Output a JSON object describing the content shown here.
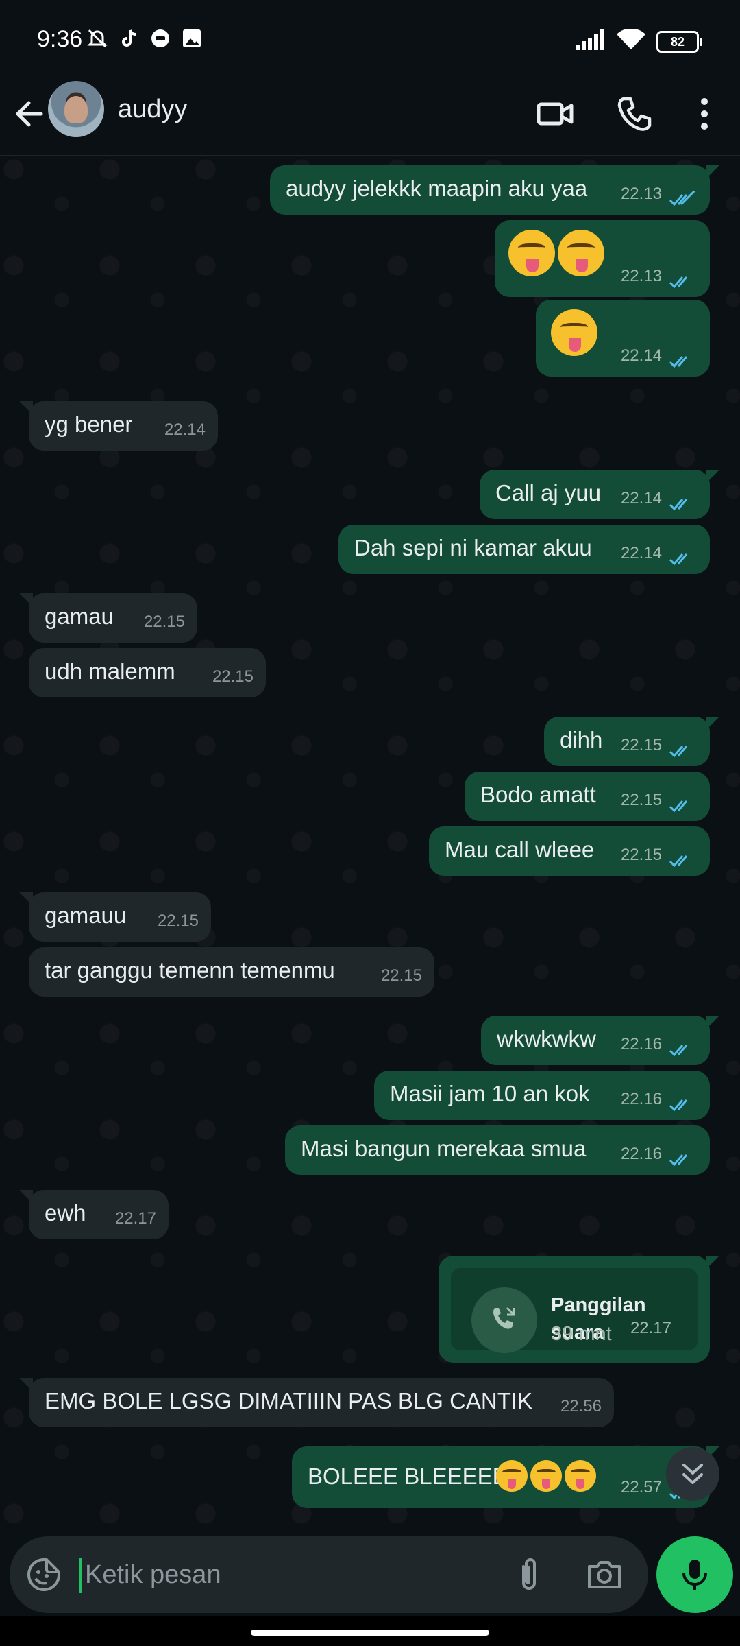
{
  "status_bar": {
    "time": "9:36",
    "battery": "82"
  },
  "header": {
    "contact_name": "audyy"
  },
  "messages": [
    {
      "dir": "out",
      "text": "audyy jelekkk maapin aku yaa",
      "time": "22.13"
    },
    {
      "dir": "out",
      "emoji": [
        "squinting-face-with-tongue",
        "squinting-face-with-tongue"
      ],
      "time": "22.13"
    },
    {
      "dir": "out",
      "emoji": [
        "face-savoring-food"
      ],
      "time": "22.14"
    },
    {
      "dir": "in",
      "text": "yg bener",
      "time": "22.14"
    },
    {
      "dir": "out",
      "text": "Call aj yuu",
      "time": "22.14"
    },
    {
      "dir": "out",
      "text": "Dah sepi ni kamar akuu",
      "time": "22.14"
    },
    {
      "dir": "in",
      "text": "gamau",
      "time": "22.15"
    },
    {
      "dir": "in",
      "text": "udh malemm",
      "time": "22.15"
    },
    {
      "dir": "out",
      "text": "dihh",
      "time": "22.15"
    },
    {
      "dir": "out",
      "text": "Bodo amatt",
      "time": "22.15"
    },
    {
      "dir": "out",
      "text": "Mau call wleee",
      "time": "22.15"
    },
    {
      "dir": "in",
      "text": "gamauu",
      "time": "22.15"
    },
    {
      "dir": "in",
      "text": "tar ganggu temenn temenmu",
      "time": "22.15"
    },
    {
      "dir": "out",
      "text": "wkwkwkw",
      "time": "22.16"
    },
    {
      "dir": "out",
      "text": "Masii jam 10 an kok",
      "time": "22.16"
    },
    {
      "dir": "out",
      "text": "Masi bangun merekaa smua",
      "time": "22.16"
    },
    {
      "dir": "in",
      "text": "ewh",
      "time": "22.17"
    },
    {
      "dir": "out",
      "call": {
        "title": "Panggilan suara",
        "duration": "39 mnt"
      },
      "time": "22.17"
    },
    {
      "dir": "in",
      "text": "EMG BOLE LGSG DIMATIIIN PAS BLG CANTIK",
      "time": "22.56"
    },
    {
      "dir": "out",
      "text": "BOLEEE BLEEEEE",
      "emoji_suffix": [
        "squinting-face-with-tongue",
        "squinting-face-with-tongue",
        "squinting-face-with-tongue"
      ],
      "time": "22.57"
    }
  ],
  "input": {
    "placeholder": "Ketik pesan"
  },
  "colors": {
    "accent": "#21c063",
    "outgoing_bubble": "#144d37",
    "incoming_bubble": "#1f272a",
    "read_ticks": "#53bdeb"
  }
}
